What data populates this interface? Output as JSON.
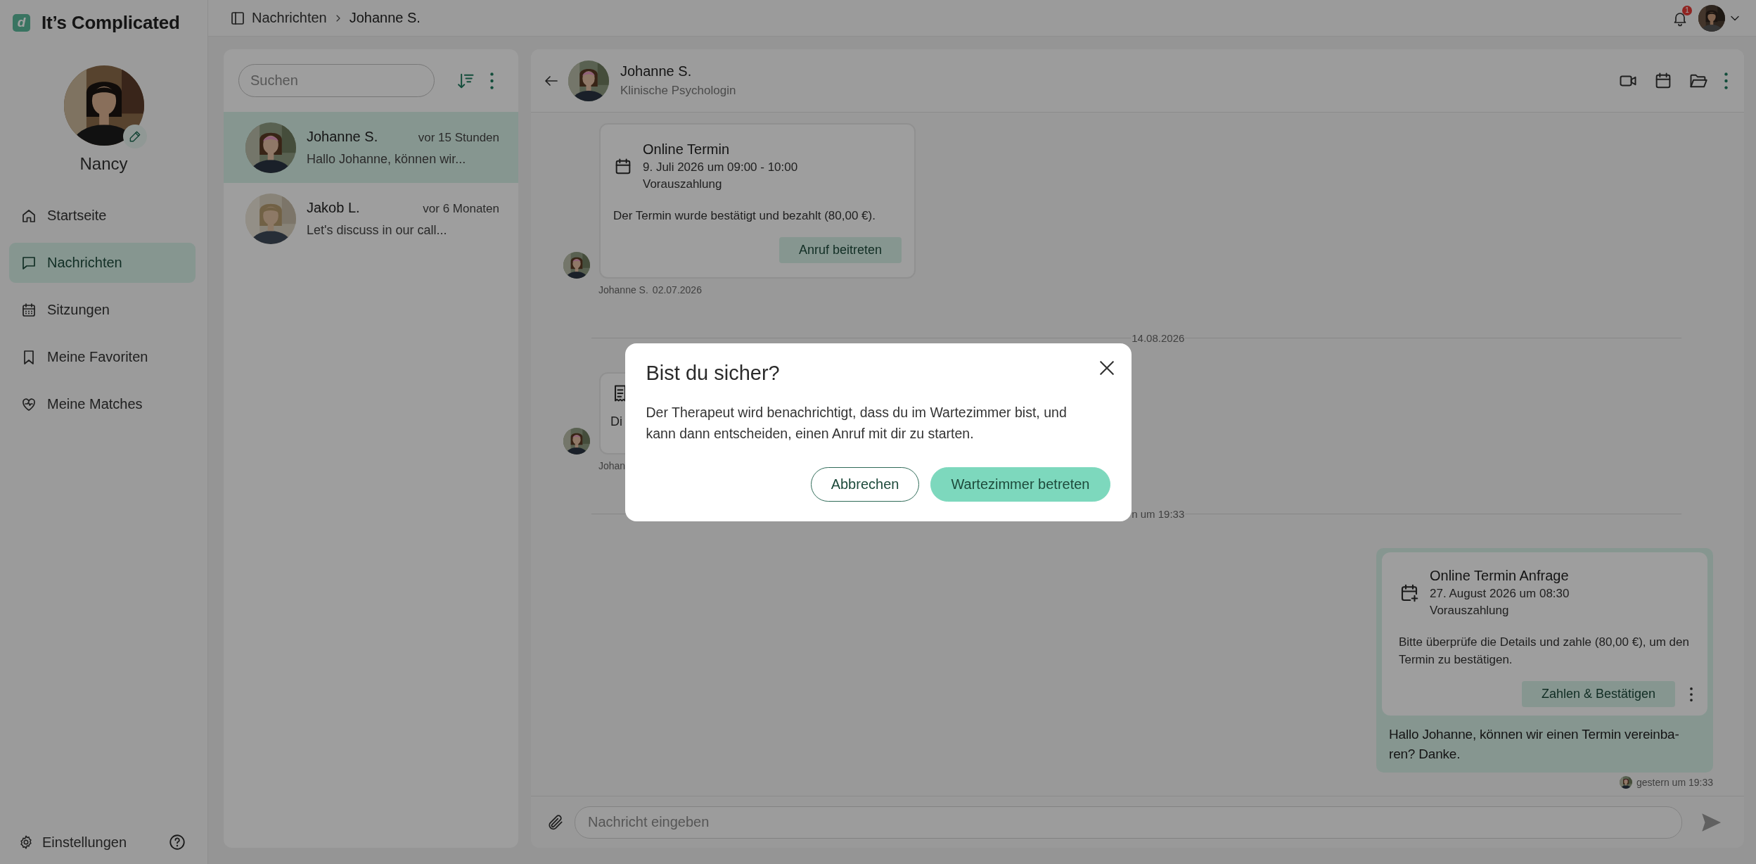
{
  "app": {
    "logo_letter": "d",
    "name": "It’s Complicated"
  },
  "profile": {
    "name": "Nancy"
  },
  "nav": [
    {
      "kind": "home",
      "label": "Startseite",
      "selected": false
    },
    {
      "kind": "messages",
      "label": "Nachrichten",
      "selected": true
    },
    {
      "kind": "sessions",
      "label": "Sitzungen",
      "selected": false
    },
    {
      "kind": "favorites",
      "label": "Meine Favoriten",
      "selected": false
    },
    {
      "kind": "matches",
      "label": "Meine Matches",
      "selected": false
    }
  ],
  "settings": {
    "label": "Einstellungen"
  },
  "breadcrumb": [
    {
      "label": "Nachrichten"
    },
    {
      "label": "Johanne S."
    }
  ],
  "notifications": {
    "count": "1"
  },
  "conversations": {
    "search": {
      "placeholder": "Suchen"
    },
    "items": [
      {
        "name": "Johanne S.",
        "time": "vor 15 Stunden",
        "preview": "Hallo Johanne, können wir...",
        "selected": true
      },
      {
        "name": "Jakob L.",
        "time": "vor 6 Monaten",
        "preview": "Let's discuss in our call...",
        "selected": false
      }
    ]
  },
  "chat": {
    "contact": {
      "name": "Johanne S.",
      "role": "Klinische Psychologin"
    },
    "messages": [
      {
        "kind": "appointment",
        "title": "Online Termin",
        "lines": [
          "9. Juli 2026 um 09:00 - 10:00",
          "Vorauszahlung"
        ],
        "note": "Der Termin wurde bestätigt und bezahlt (80,00 €).",
        "action": "Anruf beitreten",
        "sender": "Johanne S.",
        "date": "02.07.2026"
      },
      {
        "kind": "date",
        "label": "14.08.2026"
      },
      {
        "kind": "document",
        "note": "Di",
        "sender": "Johan"
      },
      {
        "kind": "date",
        "label": "n um 19:33"
      },
      {
        "kind": "request",
        "title": "Online Termin Anfrage",
        "lines": [
          "27. August 2026 um 08:30",
          "Vorauszahlung"
        ],
        "note": "Bitte überprüfe die Details und zahle (80,00 €), um den Termin zu bestätigen.",
        "action": "Zahlen & Bestätigen",
        "text": "Hallo Johanne, können wir einen Termin vereinba-ren? Danke.",
        "time": "gestern um 19:33"
      }
    ],
    "composer": {
      "placeholder": "Nachricht eingeben"
    }
  },
  "dialog": {
    "title": "Bist du sicher?",
    "body": "Der Therapeut wird benachrichtigt, dass du im Wartezimmer bist, und kann dann entscheiden, einen Anruf mit dir zu starten.",
    "buttons": [
      {
        "kind": "secondary",
        "label": "Abbrechen"
      },
      {
        "kind": "primary",
        "label": "Wartezimmer betreten"
      }
    ]
  }
}
